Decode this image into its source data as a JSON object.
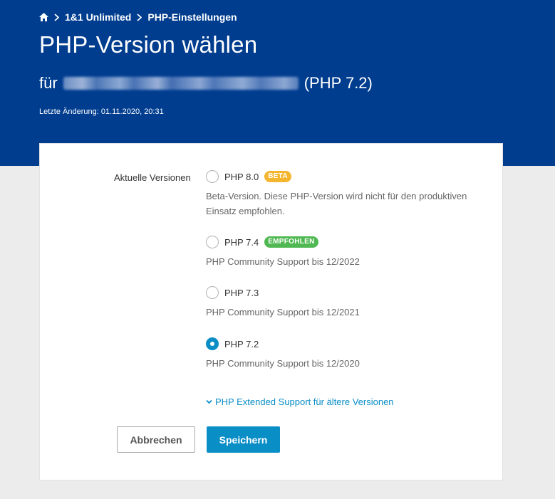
{
  "breadcrumb": {
    "items": [
      "1&1 Unlimited",
      "PHP-Einstellungen"
    ]
  },
  "header": {
    "title": "PHP-Version wählen",
    "subtitle_prefix": "für",
    "subtitle_suffix": "(PHP 7.2)",
    "last_change": "Letzte Änderung: 01.11.2020, 20:31"
  },
  "form": {
    "field_label": "Aktuelle Versionen",
    "options": [
      {
        "label": "PHP 8.0",
        "badge": "BETA",
        "description": "Beta-Version. Diese PHP-Version wird nicht für den produktiven Einsatz empfohlen.",
        "selected": false
      },
      {
        "label": "PHP 7.4",
        "badge": "EMPFOHLEN",
        "description": "PHP Community Support bis 12/2022",
        "selected": false
      },
      {
        "label": "PHP 7.3",
        "badge": "",
        "description": "PHP Community Support bis 12/2021",
        "selected": false
      },
      {
        "label": "PHP 7.2",
        "badge": "",
        "description": "PHP Community Support bis 12/2020",
        "selected": true
      }
    ],
    "extended_link": "PHP Extended Support für ältere Versionen",
    "cancel_label": "Abbrechen",
    "save_label": "Speichern"
  },
  "colors": {
    "header_bg": "#003d8f",
    "accent": "#0a8ec6",
    "beta_badge": "#f4b52f",
    "recommended_badge": "#4fb852"
  },
  "icons": {
    "home": "home-icon",
    "separator": "chevron-right-icon",
    "expand": "chevron-down-icon"
  }
}
